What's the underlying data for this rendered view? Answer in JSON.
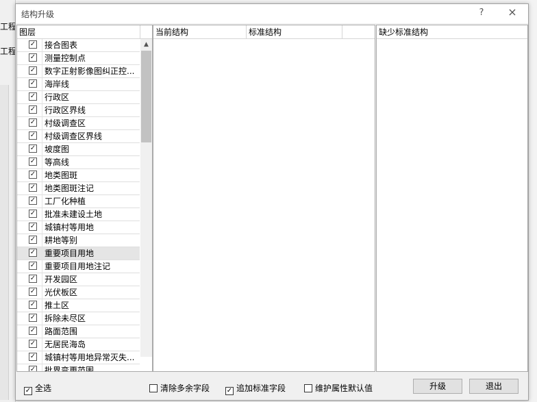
{
  "background": {
    "left_labels": [
      "工程",
      "工程管"
    ]
  },
  "dialog": {
    "title": "结构升级",
    "help_glyph": "?",
    "close_glyph": "×"
  },
  "layers": {
    "header": "图层",
    "items": [
      {
        "label": "接合图表",
        "checked": true
      },
      {
        "label": "测量控制点",
        "checked": true
      },
      {
        "label": "数字正射影像图纠正控...",
        "checked": true
      },
      {
        "label": "海岸线",
        "checked": true
      },
      {
        "label": "行政区",
        "checked": true
      },
      {
        "label": "行政区界线",
        "checked": true
      },
      {
        "label": "村级调查区",
        "checked": true
      },
      {
        "label": "村级调查区界线",
        "checked": true
      },
      {
        "label": "坡度图",
        "checked": true
      },
      {
        "label": "等高线",
        "checked": true
      },
      {
        "label": "地类图斑",
        "checked": true
      },
      {
        "label": "地类图斑注记",
        "checked": true
      },
      {
        "label": "工厂化种植",
        "checked": true
      },
      {
        "label": "批准未建设土地",
        "checked": true
      },
      {
        "label": "城镇村等用地",
        "checked": true
      },
      {
        "label": "耕地等别",
        "checked": true
      },
      {
        "label": "重要项目用地",
        "checked": true,
        "selected": true
      },
      {
        "label": "重要项目用地注记",
        "checked": true
      },
      {
        "label": "开发园区",
        "checked": true
      },
      {
        "label": "光伏板区",
        "checked": true
      },
      {
        "label": "推土区",
        "checked": true
      },
      {
        "label": "拆除未尽区",
        "checked": true
      },
      {
        "label": "路面范围",
        "checked": true
      },
      {
        "label": "无居民海岛",
        "checked": true
      },
      {
        "label": "城镇村等用地异常灭失...",
        "checked": true
      },
      {
        "label": "批界变更范围",
        "checked": true
      }
    ]
  },
  "structure": {
    "col_current": "当前结构",
    "col_standard": "标准结构",
    "col_extra": ""
  },
  "missing": {
    "header": "缺少标准结构"
  },
  "footer": {
    "select_all": {
      "label": "全选",
      "checked": true
    },
    "remove_extra": {
      "label": "清除多余字段",
      "checked": false
    },
    "add_standard": {
      "label": "追加标准字段",
      "checked": true
    },
    "keep_defaults": {
      "label": "维护属性默认值",
      "checked": false
    },
    "upgrade_button": "升级",
    "exit_button": "退出"
  },
  "glyphs": {
    "check": "✓",
    "scroll_up": "▲"
  }
}
